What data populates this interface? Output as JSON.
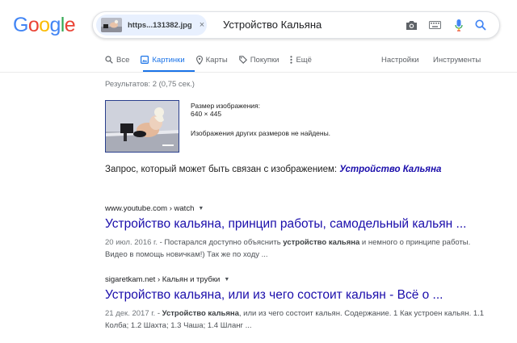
{
  "header": {
    "logo": [
      "G",
      "o",
      "o",
      "g",
      "l",
      "e"
    ],
    "logo_colors": [
      "#4285f4",
      "#ea4335",
      "#fbbc05",
      "#4285f4",
      "#34a853",
      "#ea4335"
    ],
    "image_chip": {
      "filename": "https...131382.jpg",
      "close": "×"
    },
    "query": "Устройство Кальяна",
    "icons": [
      "camera-icon",
      "keyboard-icon",
      "microphone-icon",
      "search-icon"
    ]
  },
  "tabs": {
    "items": [
      {
        "label": "Все",
        "icon": "search-icon",
        "active": false
      },
      {
        "label": "Картинки",
        "icon": "image-icon",
        "active": true
      },
      {
        "label": "Карты",
        "icon": "map-pin-icon",
        "active": false
      },
      {
        "label": "Покупки",
        "icon": "tag-icon",
        "active": false
      },
      {
        "label": "Ещё",
        "icon": "more-vertical-icon",
        "active": false
      }
    ],
    "settings": "Настройки",
    "tools": "Инструменты",
    "accent": "#1a73e8"
  },
  "results": {
    "stats": "Результатов: 2 (0,75 сек.)",
    "image_info": {
      "size_label": "Размер изображения:",
      "size_value": "640 × 445",
      "no_other_sizes": "Изображения других размеров не найдены."
    },
    "related": {
      "prefix": "Запрос, который может быть связан с изображением:",
      "link": "Устройство Кальяна"
    },
    "items": [
      {
        "cite": "www.youtube.com › watch",
        "title": "Устройство кальяна, принцип работы, самодельный кальян ...",
        "date": "20 июл. 2016 г.",
        "snippet_a": " - Постарался доступно объяснить ",
        "snippet_bold": "устройство кальяна",
        "snippet_b": " и немного о принципе работы. Видео в помощь новичкам!) Так же по ходу ..."
      },
      {
        "cite": "sigaretkam.net › Кальян и трубки",
        "title": "Устройство кальяна, или из чего состоит кальян - Всё о ...",
        "date": "21 дек. 2017 г.",
        "snippet_a": " - ",
        "snippet_bold": "Устройство кальяна",
        "snippet_b": ", или из чего состоит кальян. Содержание. 1 Как устроен кальян. 1.1 Колба; 1.2 Шахта; 1.3 Чаша; 1.4 Шланг ..."
      }
    ],
    "link_color": "#1a0dab"
  }
}
